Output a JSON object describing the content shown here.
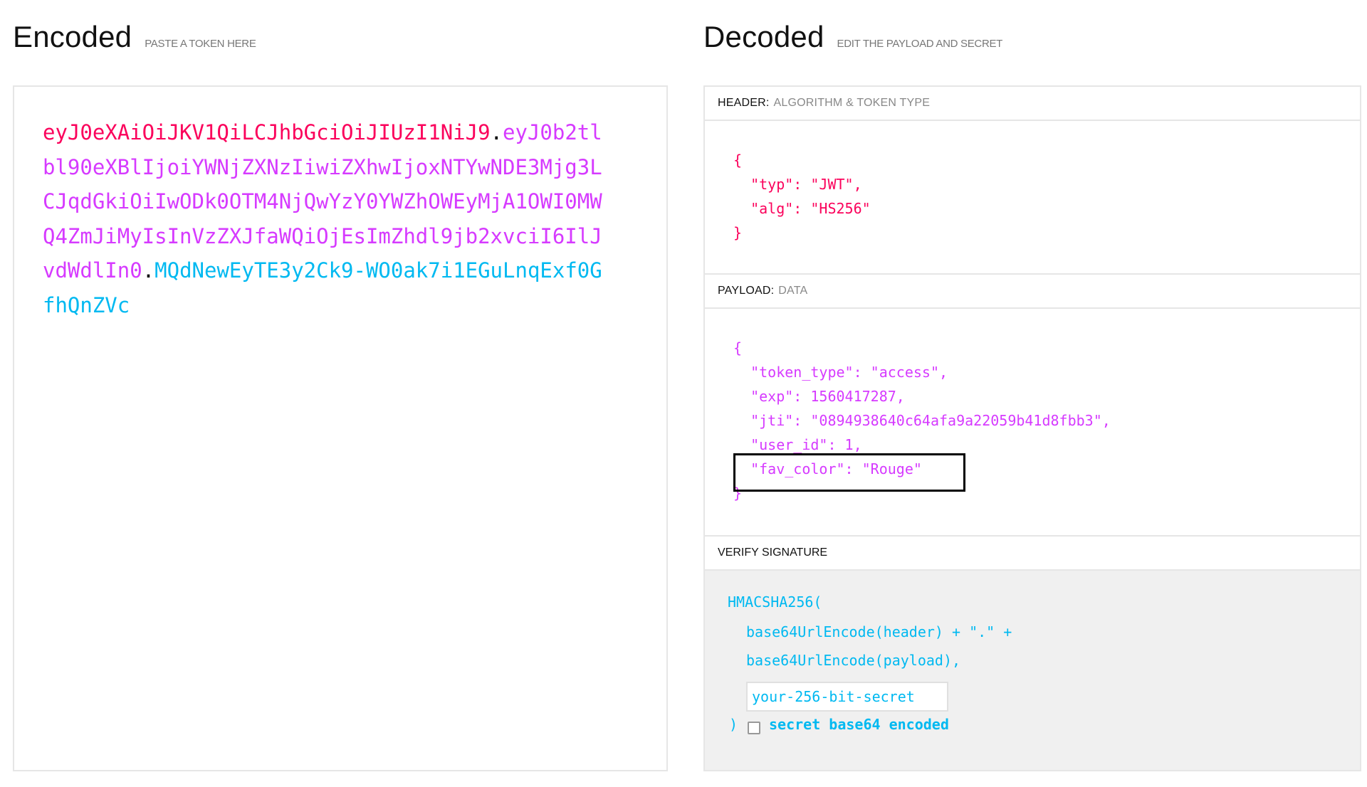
{
  "encoded": {
    "title": "Encoded",
    "subtitle": "PASTE A TOKEN HERE",
    "token": {
      "header": "eyJ0eXAiOiJKV1QiLCJhbGciOiJIUzI1NiJ9",
      "dot1": ".",
      "payload": "eyJ0b2tlbl90eXBlIjoiYWNjZXNzIiwiZXhwIjoxNTYwNDE3Mjg3LCJqdGkiOiIwODk0OTM4NjQwYzY0YWZhOWEyMjA1OWI0MWQ4ZmJiMyIsInVzZXJfaWQiOjEsImZhdl9jb2xvciI6IlJvdWdlIn0",
      "dot2": ".",
      "signature": "MQdNewEyTE3y2Ck9-WO0ak7i1EGuLnqExf0GfhQnZVc"
    }
  },
  "decoded": {
    "title": "Decoded",
    "subtitle": "EDIT THE PAYLOAD AND SECRET",
    "header_section": {
      "label": "HEADER:",
      "sublabel": "ALGORITHM & TOKEN TYPE",
      "lines": [
        "{",
        "  \"typ\": \"JWT\",",
        "  \"alg\": \"HS256\"",
        "}"
      ]
    },
    "payload_section": {
      "label": "PAYLOAD:",
      "sublabel": "DATA",
      "lines": [
        "{",
        "  \"token_type\": \"access\",",
        "  \"exp\": 1560417287,",
        "  \"jti\": \"0894938640c64afa9a22059b41d8fbb3\",",
        "  \"user_id\": 1,",
        "  \"fav_color\": \"Rouge\"",
        "}"
      ]
    },
    "verify_section": {
      "label": "VERIFY SIGNATURE",
      "line1": "HMACSHA256(",
      "line2": "base64UrlEncode(header) + \".\" +",
      "line3": "base64UrlEncode(payload),",
      "secret_placeholder": "your-256-bit-secret",
      "close": ")",
      "checkbox_label": "secret base64 encoded"
    }
  },
  "colors": {
    "header": "#fb015b",
    "payload": "#d63aff",
    "signature": "#00b9f1"
  }
}
